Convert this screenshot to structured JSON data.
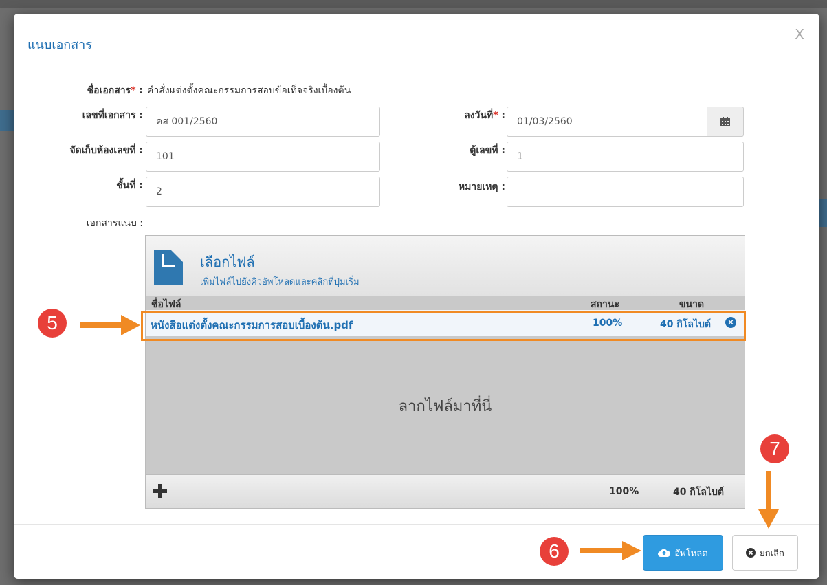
{
  "modal": {
    "title": "แนบเอกสาร",
    "close_label": "X"
  },
  "form": {
    "doc_name_label": "ชื่อเอกสาร",
    "doc_name_required": "*",
    "doc_name_colon": " :",
    "doc_name_value": "คำสั่งแต่งตั้งคณะกรรมการสอบข้อเท็จจริงเบื้องต้น",
    "doc_no_label": "เลขที่เอกสาร :",
    "doc_no_value": "คส 001/2560",
    "date_label": "ลงวันที่",
    "date_required": "*",
    "date_colon": " :",
    "date_value": "01/03/2560",
    "room_label": "จัดเก็บห้องเลขที่ :",
    "room_value": "101",
    "cabinet_label": "ตู้เลขที่ :",
    "cabinet_value": "1",
    "floor_label": "ชั้นที่ :",
    "floor_value": "2",
    "remark_label": "หมายเหตุ :",
    "remark_value": "",
    "attachment_label": "เอกสารแนบ :"
  },
  "uploader": {
    "choose_title": "เลือกไฟล์",
    "choose_subtitle": "เพิ่มไฟล์ไปยังคิวอัพโหลดและคลิกที่ปุ่มเริ่ม",
    "col_filename": "ชื่อไฟล์",
    "col_status": "สถานะ",
    "col_size": "ขนาด",
    "files": [
      {
        "name": "หนังสือแต่งตั้งคณะกรรมการสอบเบื้องต้น.pdf",
        "status": "100%",
        "size": "40 กิโลไบต์"
      }
    ],
    "drop_text": "ลากไฟล์มาที่นี่",
    "total_percent": "100%",
    "total_size": "40 กิโลไบต์"
  },
  "footer": {
    "upload_label": "อัพโหลด",
    "cancel_label": "ยกเลิก"
  },
  "annotations": {
    "step5": "5",
    "step6": "6",
    "step7": "7",
    "accent": "#f08a24",
    "badge_color": "#e8403a"
  }
}
